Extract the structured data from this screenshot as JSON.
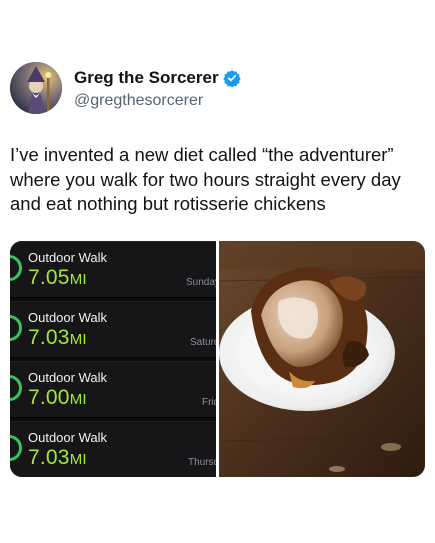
{
  "post": {
    "display_name": "Greg the Sorcerer",
    "handle": "@gregthesorcerer",
    "text_lines": [
      "I’ve invented a new diet called “the adventurer”",
      "where you walk for two hours straight every day",
      "and eat nothing but rotisserie chickens"
    ]
  },
  "workouts": [
    {
      "title": "Outdoor Walk",
      "distance": "7.05",
      "unit": "MI",
      "day": "Sunday"
    },
    {
      "title": "Outdoor Walk",
      "distance": "7.03",
      "unit": "MI",
      "day": "Saturday"
    },
    {
      "title": "Outdoor Walk",
      "distance": "7.00",
      "unit": "MI",
      "day": "Friday"
    },
    {
      "title": "Outdoor Walk",
      "distance": "7.03",
      "unit": "MI",
      "day": "Thursday"
    }
  ],
  "colors": {
    "verified_badge": "#1d9bf0",
    "distance_green": "#a6e63c",
    "ring_green": "#37c45a"
  },
  "icons": {
    "verified": "verified-badge-icon"
  }
}
